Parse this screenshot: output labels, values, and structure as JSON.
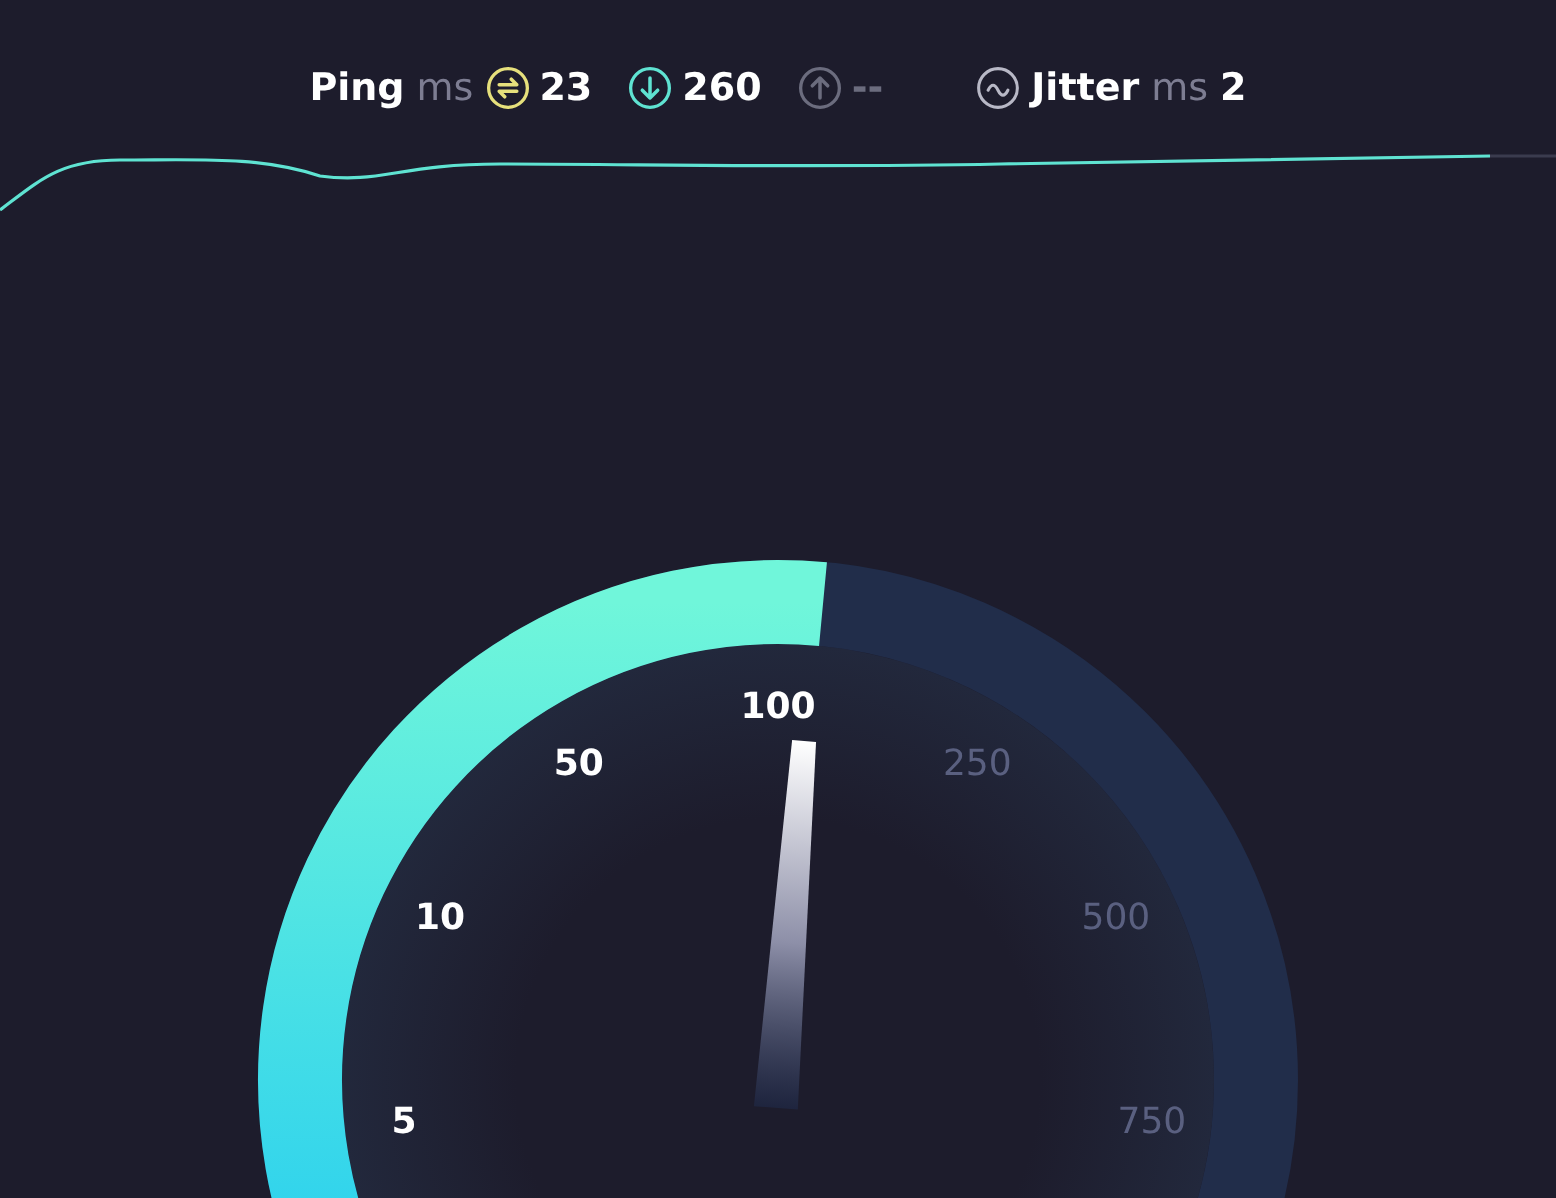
{
  "ping": {
    "label": "Ping",
    "unit": "ms"
  },
  "stats": [
    {
      "kind": "ping",
      "value": "23",
      "active": true
    },
    {
      "kind": "download",
      "value": "260",
      "active": true
    },
    {
      "kind": "upload",
      "value": "--",
      "active": false
    }
  ],
  "jitter": {
    "label": "Jitter",
    "unit": "ms",
    "value": "2"
  },
  "gauge": {
    "labels": [
      {
        "text": "5",
        "reached": true
      },
      {
        "text": "10",
        "reached": true
      },
      {
        "text": "50",
        "reached": true
      },
      {
        "text": "100",
        "reached": true
      },
      {
        "text": "250",
        "reached": false
      },
      {
        "text": "500",
        "reached": false
      },
      {
        "text": "750",
        "reached": false
      }
    ]
  }
}
